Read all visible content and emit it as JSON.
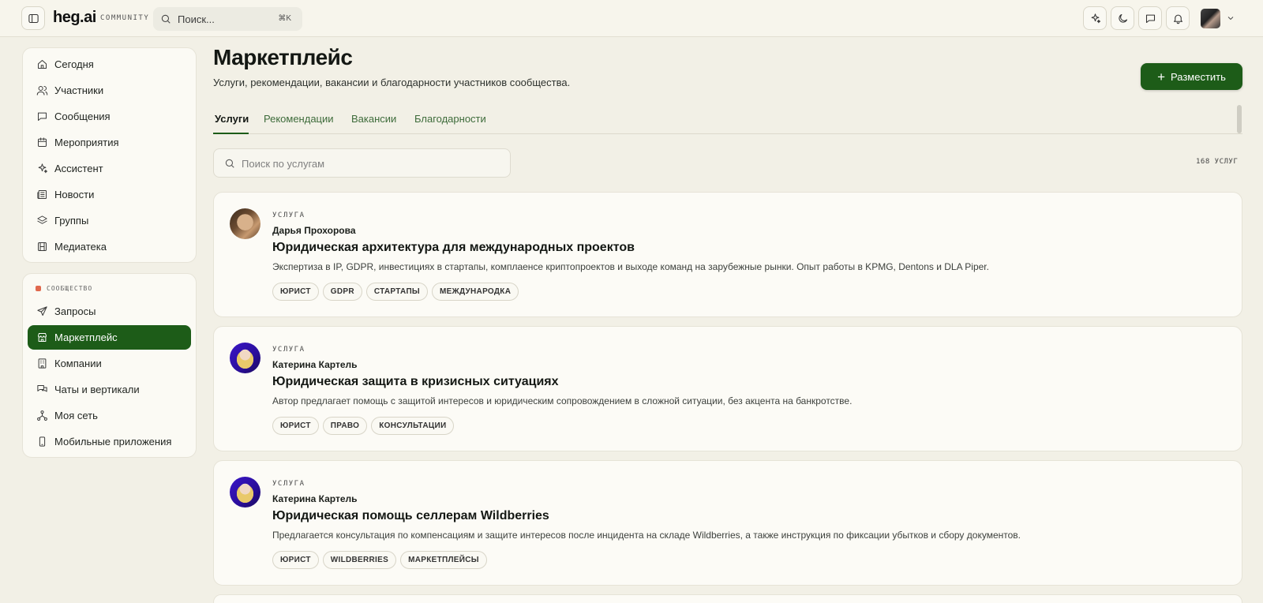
{
  "header": {
    "logo": "heg.ai",
    "logo_sub": "COMMUNITY",
    "search_placeholder": "Поиск...",
    "search_shortcut": "⌘K"
  },
  "sidebar": {
    "main_items": [
      {
        "label": "Сегодня",
        "icon": "home-icon"
      },
      {
        "label": "Участники",
        "icon": "users-icon"
      },
      {
        "label": "Сообщения",
        "icon": "message-icon"
      },
      {
        "label": "Мероприятия",
        "icon": "calendar-icon"
      },
      {
        "label": "Ассистент",
        "icon": "sparkles-icon"
      },
      {
        "label": "Новости",
        "icon": "newspaper-icon"
      },
      {
        "label": "Группы",
        "icon": "layers-icon"
      },
      {
        "label": "Медиатека",
        "icon": "film-icon"
      }
    ],
    "community_title": "СООБЩЕСТВО",
    "community_items": [
      {
        "label": "Запросы",
        "icon": "send-icon"
      },
      {
        "label": "Маркетплейс",
        "icon": "store-icon",
        "active": true
      },
      {
        "label": "Компании",
        "icon": "building-icon"
      },
      {
        "label": "Чаты и вертикали",
        "icon": "chats-icon"
      },
      {
        "label": "Моя сеть",
        "icon": "network-icon"
      },
      {
        "label": "Мобильные приложения",
        "icon": "smartphone-icon"
      }
    ]
  },
  "main": {
    "title": "Маркетплейс",
    "subtitle": "Услуги, рекомендации, вакансии и благодарности участников сообщества.",
    "post_button": "Разместить",
    "tabs": [
      "Услуги",
      "Рекомендации",
      "Вакансии",
      "Благодарности"
    ],
    "search_placeholder": "Поиск по услугам",
    "count": "168 УСЛУГ",
    "cards": [
      {
        "kind": "УСЛУГА",
        "author": "Дарья Прохорова",
        "title": "Юридическая архитектура для международных проектов",
        "description": "Экспертиза в IP, GDPR, инвестициях в стартапы, комплаенсе криптопроектов и выходе команд на зарубежные рынки. Опыт работы в KPMG, Dentons и DLA Piper.",
        "tags": [
          "ЮРИСТ",
          "GDPR",
          "СТАРТАПЫ",
          "МЕЖДУНАРОДКА"
        ]
      },
      {
        "kind": "УСЛУГА",
        "author": "Катерина Картель",
        "title": "Юридическая защита в кризисных ситуациях",
        "description": "Автор предлагает помощь с защитой интересов и юридическим сопровождением в сложной ситуации, без акцента на банкротстве.",
        "tags": [
          "ЮРИСТ",
          "ПРАВО",
          "КОНСУЛЬТАЦИИ"
        ]
      },
      {
        "kind": "УСЛУГА",
        "author": "Катерина Картель",
        "title": "Юридическая помощь селлерам Wildberries",
        "description": "Предлагается консультация по компенсациям и защите интересов после инцидента на складе Wildberries, а также инструкция по фиксации убытков и сбору документов.",
        "tags": [
          "ЮРИСТ",
          "WILDBERRIES",
          "МАРКЕТПЛЕЙСЫ"
        ]
      }
    ]
  },
  "colors": {
    "brand": "#1d5c18",
    "background": "#f2f0e6",
    "section_dot": "#e0694e"
  }
}
